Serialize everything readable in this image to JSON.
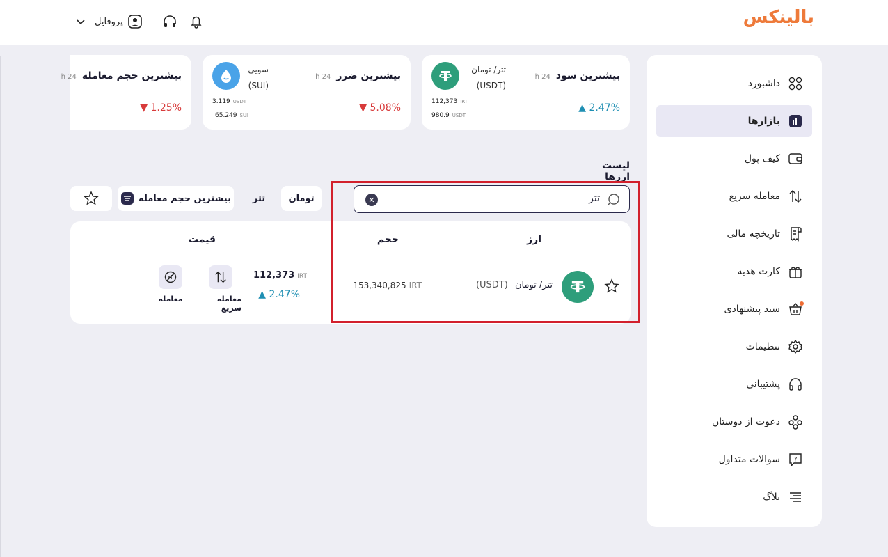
{
  "brand": {
    "name": "بالینکس",
    "accent": "#ee7a3a"
  },
  "header": {
    "profile_label": "پروفایل",
    "icons": [
      "bell-icon",
      "headphones-icon",
      "user-icon",
      "chevron-down-icon"
    ]
  },
  "sidebar": {
    "items": [
      {
        "label": "داشبورد",
        "icon": "dashboard-icon"
      },
      {
        "label": "بازارها",
        "icon": "chart-icon",
        "active": true
      },
      {
        "label": "کیف پول",
        "icon": "wallet-icon"
      },
      {
        "label": "معامله سریع",
        "icon": "swap-icon"
      },
      {
        "label": "تاریخچه مالی",
        "icon": "receipt-icon"
      },
      {
        "label": "کارت هدیه",
        "icon": "gift-icon"
      },
      {
        "label": "سبد پیشنهادی",
        "icon": "basket-icon"
      },
      {
        "label": "تنظیمات",
        "icon": "gear-icon"
      },
      {
        "label": "پشتیبانی",
        "icon": "headphones-icon"
      },
      {
        "label": "دعوت از دوستان",
        "icon": "users-icon"
      },
      {
        "label": "سوالات متداول",
        "icon": "question-icon"
      },
      {
        "label": "بلاگ",
        "icon": "menu-icon"
      }
    ]
  },
  "cards": [
    {
      "title": "بیشترین سود",
      "period": "24 h",
      "change": "2.47%",
      "direction": "up",
      "coin_name": "تتر/ تومان",
      "coin_sub": "(USDT)",
      "val1": "112,373",
      "unit1": "IRT",
      "val2": "980.9",
      "unit2": "USDT"
    },
    {
      "title": "بیشترین ضرر",
      "period": "24 h",
      "change": "5.08%",
      "direction": "down",
      "coin_name": "سویی",
      "coin_sub": "(SUI)",
      "val1": "3.119",
      "unit1": "USDT",
      "val2": "65.249",
      "unit2": "SUI"
    },
    {
      "title": "بیشترین حجم معامله",
      "period": "24 h",
      "change": "1.25%",
      "direction": "down"
    }
  ],
  "list": {
    "title": "لیست ارزها",
    "search_value": "تتر",
    "chips": {
      "toman": "تومان",
      "tether": "تتر",
      "top_volume": "بیشترین حجم معامله"
    },
    "headers": {
      "currency": "ارز",
      "volume": "حجم",
      "price": "قیمت"
    },
    "rows": [
      {
        "name": "تتر/ تومان",
        "symbol": "(USDT)",
        "volume": "153,340,825",
        "volume_unit": "IRT",
        "price": "112,373",
        "price_unit": "IRT",
        "change": "2.47%",
        "actions": {
          "quick_trade": "معامله سریع",
          "trade": "معامله"
        }
      }
    ]
  }
}
